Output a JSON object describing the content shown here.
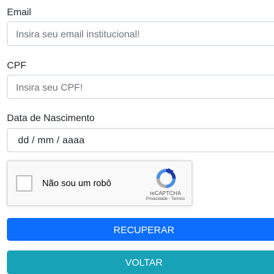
{
  "form": {
    "email": {
      "label": "Email",
      "placeholder": "Insira seu email institucional!"
    },
    "cpf": {
      "label": "CPF",
      "placeholder": "Insira seu CPF!"
    },
    "birthdate": {
      "label": "Data de Nascimento",
      "placeholder": "dd / mm / aaaa"
    }
  },
  "recaptcha": {
    "checkbox_label": "Não sou um robô",
    "brand": "reCAPTCHA",
    "links": "Privacidade - Termos",
    "icon": "recaptcha-logo"
  },
  "buttons": {
    "recover_label": "RECUPERAR",
    "back_label": "VOLTAR"
  },
  "colors": {
    "primary": "#0d6efd",
    "info": "#17a2b8",
    "input_border": "#ced4da"
  }
}
